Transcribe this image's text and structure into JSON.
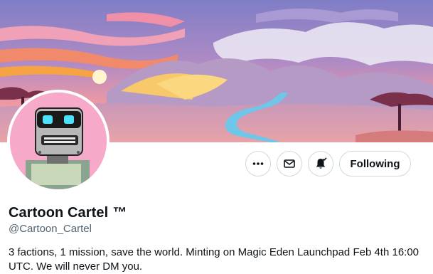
{
  "profile": {
    "display_name": "Cartoon Cartel",
    "badge": "™",
    "handle": "@Cartoon_Cartel",
    "bio": "3 factions, 1 mission, save the world. Minting on Magic Eden Launchpad Feb 4th 16:00 UTC. We will never DM you."
  },
  "actions": {
    "more_icon": "more-horizontal-icon",
    "message_icon": "envelope-icon",
    "notify_icon": "bell-notification-icon",
    "follow_label": "Following"
  },
  "colors": {
    "sky_purple": "#8d84c9",
    "sky_pink": "#ef8fa8",
    "sun_orange": "#f6a443",
    "river_blue": "#6ec7e8",
    "avatar_bg": "#f6a9c8",
    "text_primary": "#0f1419",
    "text_secondary": "#536471",
    "border": "#cfd9de"
  }
}
